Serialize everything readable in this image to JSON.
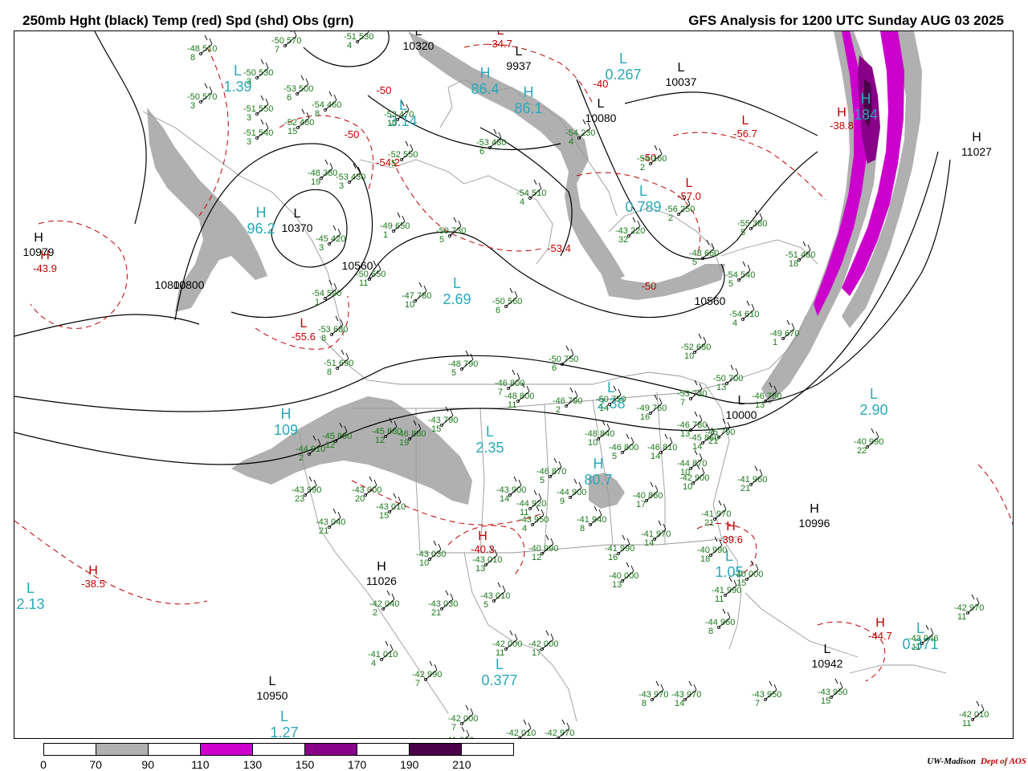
{
  "header": {
    "left_title": "250mb Hght (black) Temp (red) Spd (shd) Obs (grn)",
    "right_title": "GFS Analysis for 1200 UTC Sunday  AUG 03 2025"
  },
  "colors": {
    "height": "#000000",
    "temp": "#c00000",
    "obs": "#1a7a1a",
    "speed_label": "#2aa8b8",
    "shade_70": "#b0b0b0",
    "shade_110": "#cc00cc",
    "shade_150": "#880088",
    "shade_190": "#4a0048"
  },
  "legend": {
    "ticks": [
      "0",
      "70",
      "90",
      "110",
      "130",
      "150",
      "170",
      "190",
      "210"
    ],
    "segments": [
      "#ffffff",
      "#b0b0b0",
      "#ffffff",
      "#cc00cc",
      "#ffffff",
      "#880088",
      "#ffffff",
      "#4a0048",
      "#ffffff"
    ]
  },
  "credit": {
    "org": "UW-Madison",
    "dept": "Dept of AOS"
  },
  "pressure_centers": [
    {
      "letter": "H",
      "value": "10979"
    },
    {
      "letter": "L",
      "value": "10370"
    },
    {
      "letter": "L",
      "value": "10320"
    },
    {
      "letter": "L",
      "value": "9937"
    },
    {
      "letter": "L",
      "value": "10037"
    },
    {
      "letter": "L",
      "value": "10080"
    },
    {
      "letter": "L",
      "value": "10000"
    },
    {
      "letter": "H",
      "value": "11027"
    },
    {
      "letter": "H",
      "value": "10996"
    },
    {
      "letter": "H",
      "value": "11026"
    },
    {
      "letter": "L",
      "value": "10950"
    },
    {
      "letter": "L",
      "value": "10942"
    }
  ],
  "height_contour_labels": [
    "10560",
    "10800",
    "10560",
    "10800"
  ],
  "temp_labels": [
    {
      "letter": "H",
      "value": "-43.9"
    },
    {
      "letter": "L",
      "value": "-55.6"
    },
    {
      "letter": "H",
      "value": "-38.5"
    },
    {
      "letter": "H",
      "value": "-40.3"
    },
    {
      "letter": "H",
      "value": "-39.6"
    },
    {
      "letter": "L",
      "value": "-57.0"
    },
    {
      "letter": "L",
      "value": "-56.7"
    },
    {
      "letter": "H",
      "value": "-38.8"
    },
    {
      "letter": "H",
      "value": "-44.7"
    },
    {
      "letter": "L",
      "value": "-34.7"
    },
    {
      "letter": "",
      "value": "-50"
    },
    {
      "letter": "",
      "value": "-50"
    },
    {
      "letter": "",
      "value": "-40"
    },
    {
      "letter": "",
      "value": "-50"
    },
    {
      "letter": "",
      "value": "-50"
    },
    {
      "letter": "",
      "value": "-54.2"
    },
    {
      "letter": "",
      "value": "-53.4"
    }
  ],
  "speed_labels": [
    {
      "letter": "L",
      "value": "1.39"
    },
    {
      "letter": "L",
      "value": "3.14"
    },
    {
      "letter": "H",
      "value": "96.2"
    },
    {
      "letter": "L",
      "value": "2.69"
    },
    {
      "letter": "H",
      "value": "86.4"
    },
    {
      "letter": "H",
      "value": "86.1"
    },
    {
      "letter": "L",
      "value": "0.267"
    },
    {
      "letter": "L",
      "value": "0.789"
    },
    {
      "letter": "H",
      "value": "184"
    },
    {
      "letter": "L",
      "value": "2.38"
    },
    {
      "letter": "L",
      "value": "2.35"
    },
    {
      "letter": "H",
      "value": "109"
    },
    {
      "letter": "H",
      "value": "80.7"
    },
    {
      "letter": "L",
      "value": "2.90"
    },
    {
      "letter": "L",
      "value": "2.13"
    },
    {
      "letter": "L",
      "value": "0.377"
    },
    {
      "letter": "L",
      "value": "1.05"
    },
    {
      "letter": "L",
      "value": "0.371"
    },
    {
      "letter": "L",
      "value": "1.27"
    }
  ],
  "observations": [
    {
      "t": "-48",
      "h": "510",
      "d": "8"
    },
    {
      "t": "-50",
      "h": "570",
      "d": "7"
    },
    {
      "t": "-51",
      "h": "530",
      "d": "4"
    },
    {
      "t": "-50",
      "h": "530",
      "d": "3"
    },
    {
      "t": "-53",
      "h": "500",
      "d": "6"
    },
    {
      "t": "-50",
      "h": "570",
      "d": "3"
    },
    {
      "t": "-54",
      "h": "460",
      "d": "8"
    },
    {
      "t": "-51",
      "h": "550",
      "d": "3"
    },
    {
      "t": "-52",
      "h": "480",
      "d": "15"
    },
    {
      "t": "-51",
      "h": "540",
      "d": "3"
    },
    {
      "t": "-53",
      "h": "470",
      "d": "10"
    },
    {
      "t": "-53",
      "h": "480",
      "d": "6"
    },
    {
      "t": "-54",
      "h": "230",
      "d": "4"
    },
    {
      "t": "-52",
      "h": "550",
      "d": "5"
    },
    {
      "t": "-48",
      "h": "380",
      "d": "19"
    },
    {
      "t": "-53",
      "h": "430",
      "d": "3"
    },
    {
      "t": "-54",
      "h": "160",
      "d": "2"
    },
    {
      "t": "-54",
      "h": "510",
      "d": "4"
    },
    {
      "t": "-56",
      "h": "250",
      "d": "2"
    },
    {
      "t": "-55",
      "h": "380",
      "d": "5"
    },
    {
      "t": "-49",
      "h": "650",
      "d": "1"
    },
    {
      "t": "-50",
      "h": "730",
      "d": "5"
    },
    {
      "t": "-45",
      "h": "420",
      "d": "3"
    },
    {
      "t": "-43",
      "h": "220",
      "d": "32"
    },
    {
      "t": "-48",
      "h": "660",
      "d": "5"
    },
    {
      "t": "-50",
      "h": "650",
      "d": "11"
    },
    {
      "t": "-51",
      "h": "480",
      "d": "18"
    },
    {
      "t": "-54",
      "h": "540",
      "d": "5"
    },
    {
      "t": "-47",
      "h": "780",
      "d": "10"
    },
    {
      "t": "-50",
      "h": "560",
      "d": "6"
    },
    {
      "t": "-54",
      "h": "590",
      "d": "1"
    },
    {
      "t": "-54",
      "h": "610",
      "d": "4"
    },
    {
      "t": "-53",
      "h": "680",
      "d": "8"
    },
    {
      "t": "-49",
      "h": "670",
      "d": "1"
    },
    {
      "t": "-52",
      "h": "680",
      "d": "10"
    },
    {
      "t": "-51",
      "h": "690",
      "d": "8"
    },
    {
      "t": "-48",
      "h": "790",
      "d": "5"
    },
    {
      "t": "-50",
      "h": "750",
      "d": "6"
    },
    {
      "t": "-50",
      "h": "700",
      "d": "13"
    },
    {
      "t": "-46",
      "h": "800",
      "d": "7"
    },
    {
      "t": "-48",
      "h": "800",
      "d": "11"
    },
    {
      "t": "-46",
      "h": "790",
      "d": "2"
    },
    {
      "t": "-50",
      "h": "750",
      "d": "14"
    },
    {
      "t": "-49",
      "h": "760",
      "d": "16"
    },
    {
      "t": "-53",
      "h": "730",
      "d": "7"
    },
    {
      "t": "-46",
      "h": "780",
      "d": "13"
    },
    {
      "t": "-45",
      "h": "790",
      "d": "21"
    },
    {
      "t": "-46",
      "h": "780",
      "d": "13"
    },
    {
      "t": "-45",
      "h": "890",
      "d": "12"
    },
    {
      "t": "-44",
      "h": "910",
      "d": "2"
    },
    {
      "t": "-45",
      "h": "880",
      "d": "12"
    },
    {
      "t": "-46",
      "h": "880",
      "d": "19"
    },
    {
      "t": "-43",
      "h": "790",
      "d": "15"
    },
    {
      "t": "-48",
      "h": "840",
      "d": "10"
    },
    {
      "t": "-46",
      "h": "800",
      "d": "5"
    },
    {
      "t": "-46",
      "h": "810",
      "d": "14"
    },
    {
      "t": "-45",
      "h": "860",
      "d": "14"
    },
    {
      "t": "-40",
      "h": "990",
      "d": "22"
    },
    {
      "t": "-43",
      "h": "990",
      "d": "23"
    },
    {
      "t": "-43",
      "h": "000",
      "d": "20"
    },
    {
      "t": "-43",
      "h": "010",
      "d": "15"
    },
    {
      "t": "-46",
      "h": "870",
      "d": "5"
    },
    {
      "t": "-43",
      "h": "900",
      "d": "14"
    },
    {
      "t": "-44",
      "h": "920",
      "d": "11"
    },
    {
      "t": "-44",
      "h": "900",
      "d": "9"
    },
    {
      "t": "-43",
      "h": "950",
      "d": "4"
    },
    {
      "t": "-44",
      "h": "870",
      "d": "10"
    },
    {
      "t": "-42",
      "h": "900",
      "d": "10"
    },
    {
      "t": "-41",
      "h": "960",
      "d": "21"
    },
    {
      "t": "-40",
      "h": "860",
      "d": "17"
    },
    {
      "t": "-41",
      "h": "940",
      "d": "8"
    },
    {
      "t": "-41",
      "h": "970",
      "d": "21"
    },
    {
      "t": "-43",
      "h": "040",
      "d": "21"
    },
    {
      "t": "-43",
      "h": "030",
      "d": "10"
    },
    {
      "t": "-43",
      "h": "010",
      "d": "13"
    },
    {
      "t": "-40",
      "h": "990",
      "d": "12"
    },
    {
      "t": "-41",
      "h": "990",
      "d": "16"
    },
    {
      "t": "-41",
      "h": "970",
      "d": "14"
    },
    {
      "t": "-40",
      "h": "990",
      "d": "18"
    },
    {
      "t": "-40",
      "h": "000",
      "d": "13"
    },
    {
      "t": "-40",
      "h": "000",
      "d": "15"
    },
    {
      "t": "-41",
      "h": "990",
      "d": "11"
    },
    {
      "t": "-42",
      "h": "040",
      "d": "2"
    },
    {
      "t": "-43",
      "h": "030",
      "d": "21"
    },
    {
      "t": "-43",
      "h": "010",
      "d": "5"
    },
    {
      "t": "-44",
      "h": "960",
      "d": "8"
    },
    {
      "t": "-42",
      "h": "970",
      "d": "11"
    },
    {
      "t": "-43",
      "h": "946",
      "d": "11"
    },
    {
      "t": "-41",
      "h": "010",
      "d": "4"
    },
    {
      "t": "-42",
      "h": "990",
      "d": "7"
    },
    {
      "t": "-42",
      "h": "000",
      "d": "11"
    },
    {
      "t": "-42",
      "h": "000",
      "d": "17"
    },
    {
      "t": "-43",
      "h": "970",
      "d": "8"
    },
    {
      "t": "-43",
      "h": "970",
      "d": "14"
    },
    {
      "t": "-43",
      "h": "950",
      "d": "7"
    },
    {
      "t": "-43",
      "h": "950",
      "d": "15"
    },
    {
      "t": "-42",
      "h": "000",
      "d": "7"
    },
    {
      "t": "-41",
      "h": "010",
      "d": ""
    },
    {
      "t": "-42",
      "h": "010",
      "d": ""
    },
    {
      "t": "-42",
      "h": "970",
      "d": ""
    },
    {
      "t": "-42",
      "h": "010",
      "d": "11"
    }
  ]
}
